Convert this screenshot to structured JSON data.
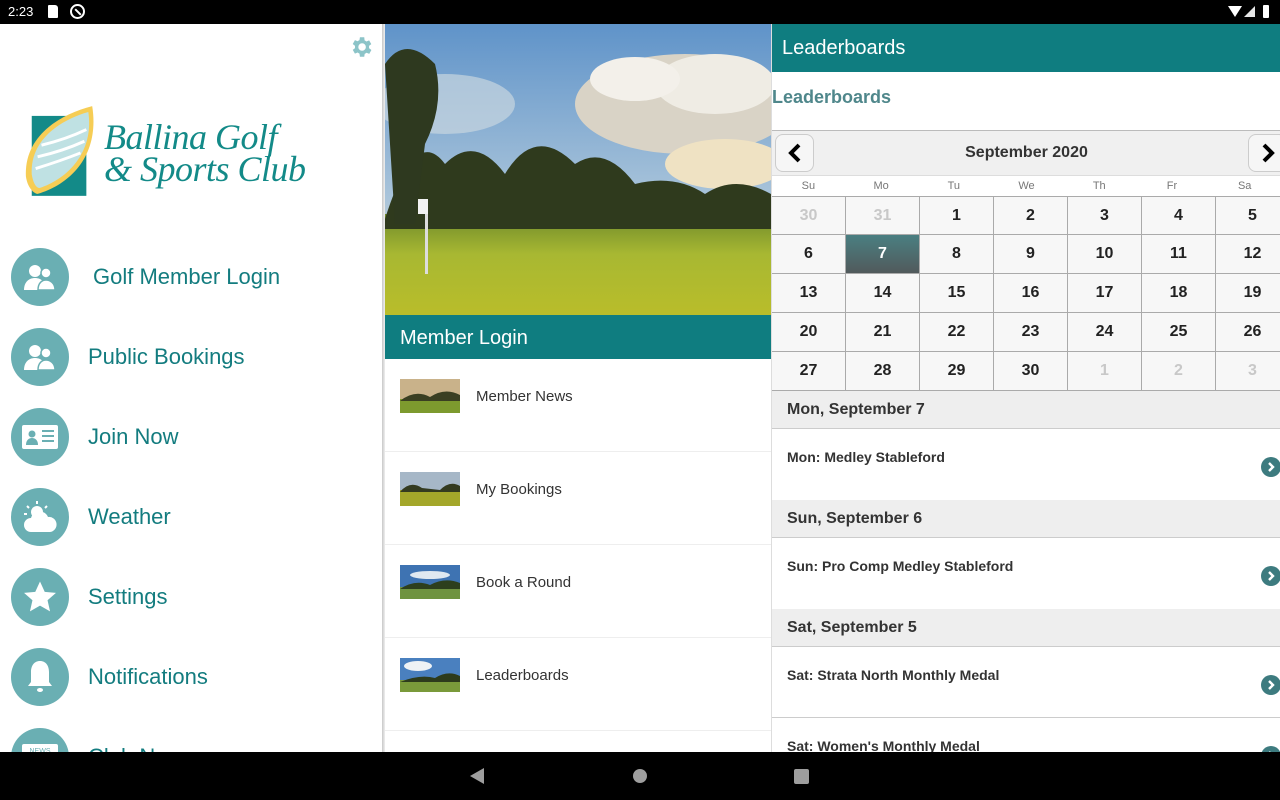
{
  "status_bar": {
    "time": "2:23"
  },
  "drawer": {
    "logo": {
      "line1": "Ballina Golf",
      "line2": "& Sports Club"
    },
    "items": [
      {
        "label": "Golf Member Login",
        "icon": "members-icon"
      },
      {
        "label": "Public Bookings",
        "icon": "members-icon"
      },
      {
        "label": "Join Now",
        "icon": "id-card-icon"
      },
      {
        "label": "Weather",
        "icon": "weather-icon"
      },
      {
        "label": "Settings",
        "icon": "star-icon"
      },
      {
        "label": "Notifications",
        "icon": "bell-icon"
      },
      {
        "label": "Club News",
        "icon": "news-icon"
      }
    ]
  },
  "middle": {
    "header": "Member Login",
    "items": [
      {
        "label": "Member News"
      },
      {
        "label": "My Bookings"
      },
      {
        "label": "Book a Round"
      },
      {
        "label": "Leaderboards"
      }
    ]
  },
  "right": {
    "header": "Leaderboards",
    "title": "Leaderboards",
    "calendar": {
      "month": "September 2020",
      "weekdays": [
        "Su",
        "Mo",
        "Tu",
        "We",
        "Th",
        "Fr",
        "Sa"
      ],
      "selected_day": 7,
      "weeks": [
        [
          {
            "d": "30",
            "m": true
          },
          {
            "d": "31",
            "m": true
          },
          {
            "d": "1"
          },
          {
            "d": "2"
          },
          {
            "d": "3"
          },
          {
            "d": "4"
          },
          {
            "d": "5"
          }
        ],
        [
          {
            "d": "6"
          },
          {
            "d": "7",
            "s": true
          },
          {
            "d": "8"
          },
          {
            "d": "9"
          },
          {
            "d": "10"
          },
          {
            "d": "11"
          },
          {
            "d": "12"
          }
        ],
        [
          {
            "d": "13"
          },
          {
            "d": "14"
          },
          {
            "d": "15"
          },
          {
            "d": "16"
          },
          {
            "d": "17"
          },
          {
            "d": "18"
          },
          {
            "d": "19"
          }
        ],
        [
          {
            "d": "20"
          },
          {
            "d": "21"
          },
          {
            "d": "22"
          },
          {
            "d": "23"
          },
          {
            "d": "24"
          },
          {
            "d": "25"
          },
          {
            "d": "26"
          }
        ],
        [
          {
            "d": "27"
          },
          {
            "d": "28"
          },
          {
            "d": "29"
          },
          {
            "d": "30"
          },
          {
            "d": "1",
            "m": true
          },
          {
            "d": "2",
            "m": true
          },
          {
            "d": "3",
            "m": true
          }
        ]
      ]
    },
    "event_groups": [
      {
        "date": "Mon, September 7",
        "events": [
          "Mon: Medley Stableford"
        ]
      },
      {
        "date": "Sun, September 6",
        "events": [
          "Sun: Pro Comp Medley Stableford"
        ]
      },
      {
        "date": "Sat, September 5",
        "events": [
          "Sat: Strata North Monthly Medal",
          "Sat: Women's Monthly Medal"
        ]
      }
    ]
  },
  "colors": {
    "header_teal": "#0f7d80",
    "menu_icon_teal": "#6aafb3",
    "menu_text_teal": "#137c7f"
  }
}
